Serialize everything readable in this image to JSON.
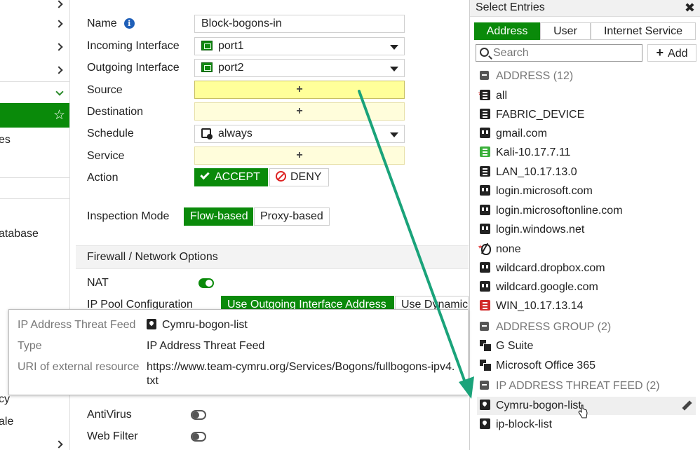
{
  "sidebar": {
    "partial_texts": [
      "es",
      "atabase",
      "cy",
      "ale"
    ]
  },
  "form": {
    "name_label": "Name",
    "name_value": "Block-bogons-in",
    "incoming_label": "Incoming Interface",
    "incoming_value": "port1",
    "outgoing_label": "Outgoing Interface",
    "outgoing_value": "port2",
    "source_label": "Source",
    "destination_label": "Destination",
    "schedule_label": "Schedule",
    "schedule_value": "always",
    "service_label": "Service",
    "action_label": "Action",
    "accept_label": "ACCEPT",
    "deny_label": "DENY",
    "plus": "+",
    "inspection_label": "Inspection Mode",
    "flow_label": "Flow-based",
    "proxy_label": "Proxy-based",
    "section_title": "Firewall / Network Options",
    "nat_label": "NAT",
    "ippool_label": "IP Pool Configuration",
    "use_outgoing_label": "Use Outgoing Interface Address",
    "use_dynamic_label": "Use Dynamic I",
    "antivirus_label": "AntiVirus",
    "webfilter_label": "Web Filter"
  },
  "tooltip": {
    "rows": [
      {
        "key": "IP Address Threat Feed",
        "value": "Cymru-bogon-list"
      },
      {
        "key": "Type",
        "value": "IP Address Threat Feed"
      },
      {
        "key": "URI of external resource",
        "value": "https://www.team-cymru.org/Services/Bogons/fullbogons-ipv4.txt"
      }
    ]
  },
  "panel": {
    "title": "Select Entries",
    "tabs": [
      "Address",
      "User",
      "Internet Service"
    ],
    "search_placeholder": "Search",
    "add_label": "Add",
    "groups": [
      {
        "title": "ADDRESS (12)"
      },
      {
        "title": "ADDRESS GROUP (2)"
      },
      {
        "title": "IP ADDRESS THREAT FEED (2)"
      }
    ],
    "addresses": [
      "all",
      "FABRIC_DEVICE",
      "gmail.com",
      "Kali-10.17.7.11",
      "LAN_10.17.13.0",
      "login.microsoft.com",
      "login.microsoftonline.com",
      "login.windows.net",
      "none",
      "wildcard.dropbox.com",
      "wildcard.google.com",
      "WIN_10.17.13.14"
    ],
    "address_groups": [
      "G Suite",
      "Microsoft Office 365"
    ],
    "threat_feeds": [
      "Cymru-bogon-list",
      "ip-block-list"
    ]
  },
  "colors": {
    "accent_green": "#0a8a0a",
    "arrow": "#1aa37a",
    "source_highlight": "#ffff9a"
  }
}
